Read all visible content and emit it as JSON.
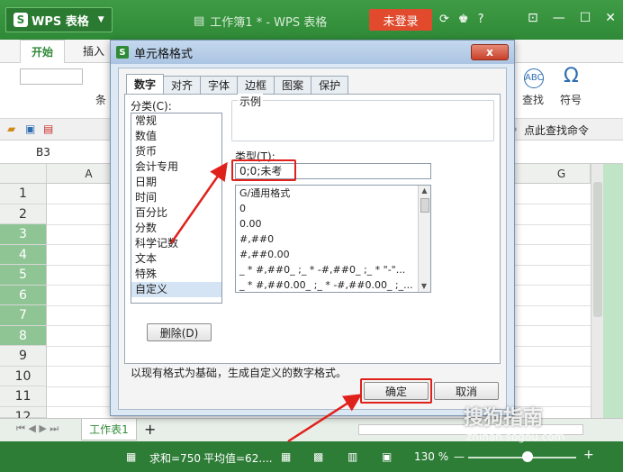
{
  "app": {
    "name": "WPS 表格",
    "window_title": "工作簿1 * - WPS 表格",
    "login_label": "未登录"
  },
  "ribbon": {
    "tabs": [
      "开始",
      "插入"
    ],
    "find_label": "查找",
    "symbol_label": "符号",
    "condition_label": "条",
    "search_cmd": "点此查找命令"
  },
  "cell_ref": "B3",
  "columns": [
    "A",
    "G"
  ],
  "rows": [
    "1",
    "2",
    "3",
    "4",
    "5",
    "6",
    "7",
    "8",
    "9",
    "10",
    "11",
    "12"
  ],
  "dialog": {
    "title": "单元格格式",
    "close_label": "x",
    "tabs": [
      "数字",
      "对齐",
      "字体",
      "边框",
      "图案",
      "保护"
    ],
    "category_label": "分类(C):",
    "categories": [
      "常规",
      "数值",
      "货币",
      "会计专用",
      "日期",
      "时间",
      "百分比",
      "分数",
      "科学记数",
      "文本",
      "特殊",
      "自定义"
    ],
    "selected_category": "自定义",
    "sample_label": "示例",
    "type_label": "类型(T):",
    "type_value": "0;0;未考",
    "formats": [
      "G/通用格式",
      "0",
      "0.00",
      "#,##0",
      "#,##0.00",
      "_ * #,##0_ ;_ * -#,##0_ ;_ * \"-\"...",
      "_ * #,##0.00_ ;_ * -#,##0.00_ ;_..."
    ],
    "delete_label": "删除(D)",
    "description": "以现有格式为基础，生成自定义的数字格式。",
    "ok_label": "确定",
    "cancel_label": "取消"
  },
  "sheet_tab": "工作表1",
  "status": {
    "sum": "求和=750",
    "avg": "平均值=62....",
    "zoom": "130 %"
  },
  "watermark": {
    "brand": "搜狗指南",
    "url": "zhinan.sogou.com"
  },
  "colors": {
    "green": "#2f8a37",
    "highlight_red": "#e0211b",
    "login_red": "#e14a2d"
  }
}
